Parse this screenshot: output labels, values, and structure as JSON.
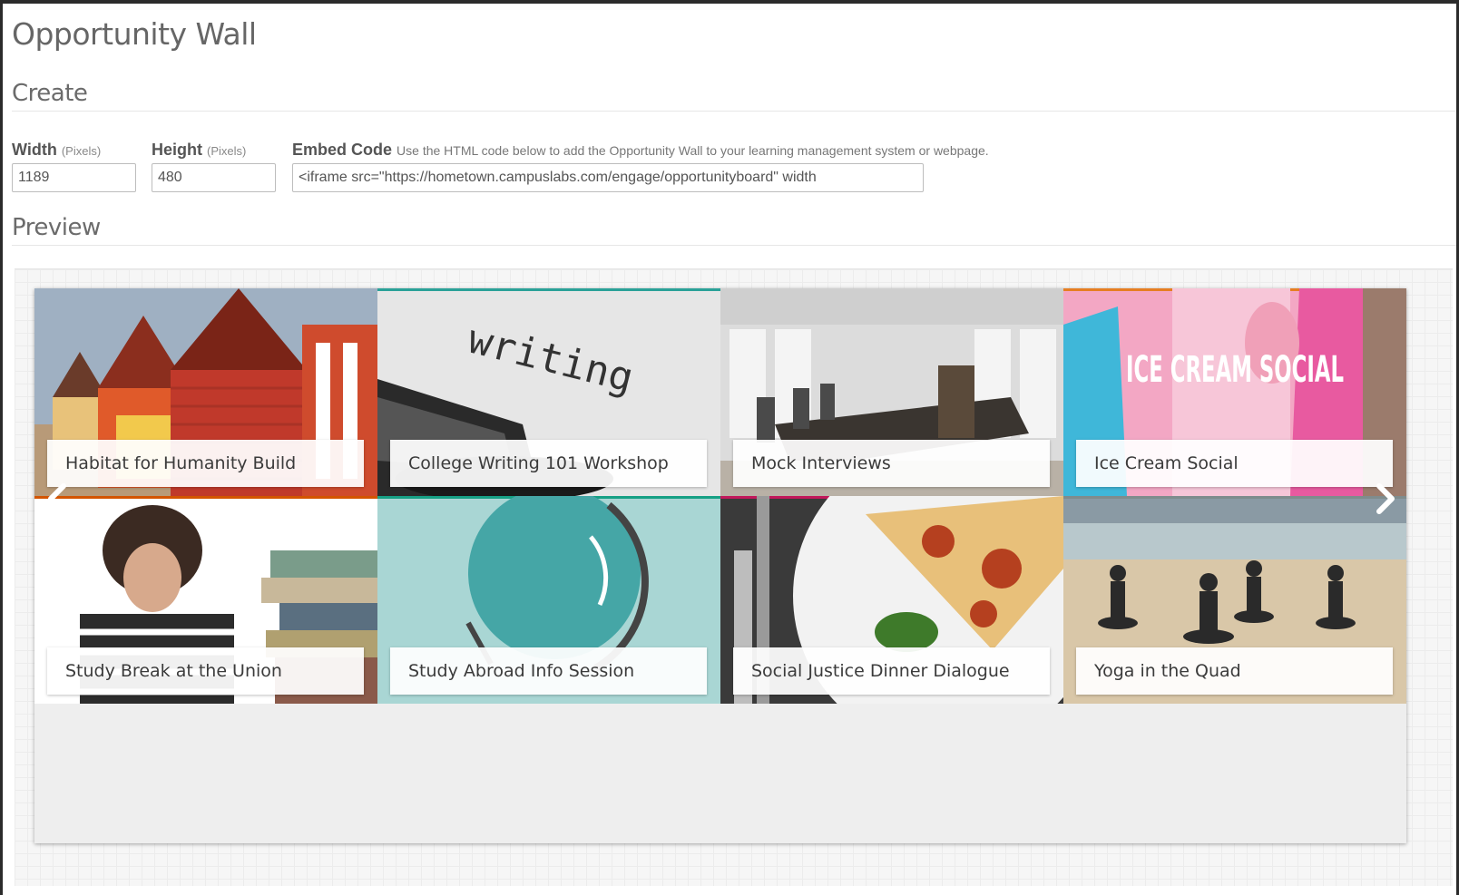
{
  "page": {
    "title": "Opportunity Wall"
  },
  "create": {
    "heading": "Create",
    "width": {
      "label": "Width",
      "unit": "(Pixels)",
      "value": "1189"
    },
    "height": {
      "label": "Height",
      "unit": "(Pixels)",
      "value": "480"
    },
    "embed": {
      "label": "Embed Code",
      "help": "Use the HTML code below to add the Opportunity Wall to your learning management system or webpage.",
      "value": "<iframe src=\"https://hometown.campuslabs.com/engage/opportunityboard\" width"
    }
  },
  "preview": {
    "heading": "Preview",
    "tiles": [
      {
        "label": "Habitat for Humanity Build",
        "accent": "#c0392b"
      },
      {
        "label": "College Writing 101 Workshop",
        "accent": "#2aa198",
        "image_text": "writing"
      },
      {
        "label": "Mock Interviews",
        "accent": "#8e44ad"
      },
      {
        "label": "Ice Cream Social",
        "accent": "#e67e22",
        "image_text": "ICE CREAM SOCIAL"
      },
      {
        "label": "Study Break at the Union",
        "accent": "#d35400"
      },
      {
        "label": "Study Abroad Info Session",
        "accent": "#16a085"
      },
      {
        "label": "Social Justice Dinner Dialogue",
        "accent": "#c2185b"
      },
      {
        "label": "Yoga in the Quad",
        "accent": "#7f8c8d"
      }
    ]
  }
}
